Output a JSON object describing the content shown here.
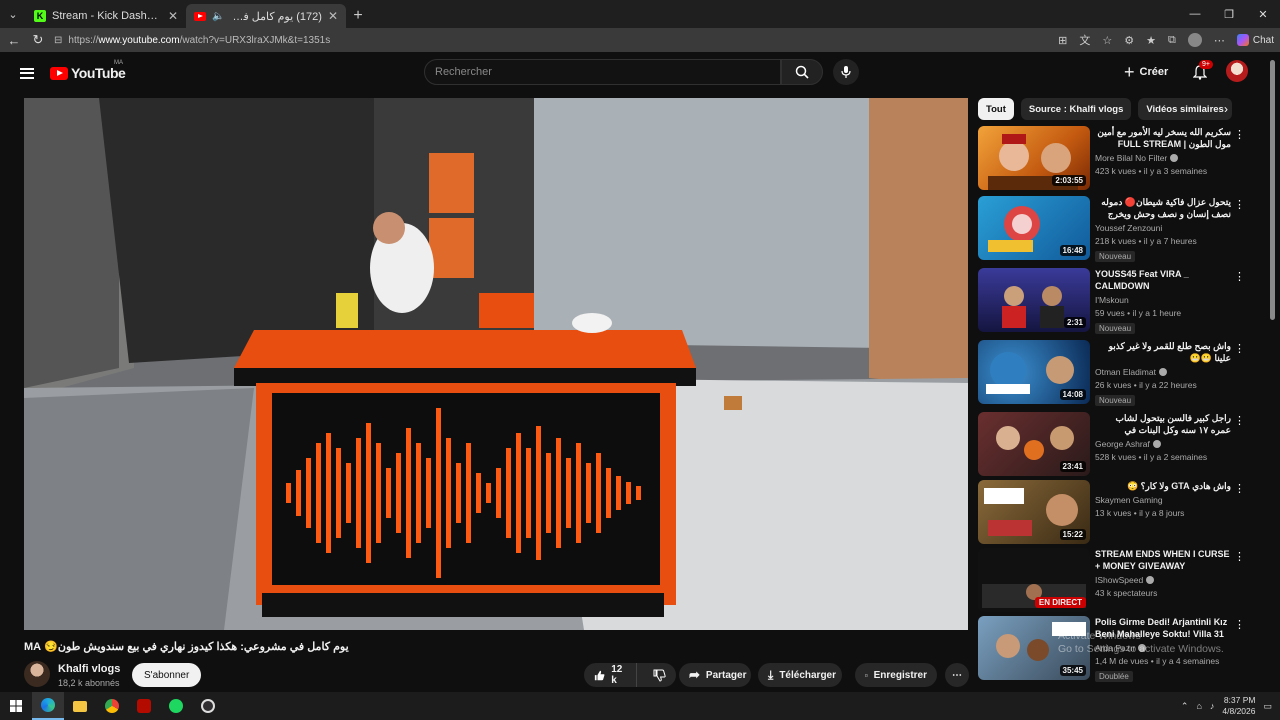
{
  "browser": {
    "tabs": [
      {
        "title": "Stream - Kick Dashboard",
        "active": false
      },
      {
        "title": "(172) يوم كامل في مشروعي: ه",
        "active": true
      }
    ],
    "url_prefix": "https://",
    "url_domain": "www.youtube.com",
    "url_path": "/watch?v=URX3lraXJMk&t=1351s",
    "chat_label": "Chat"
  },
  "header": {
    "logo_text": "YouTube",
    "country_code": "MA",
    "search_placeholder": "Rechercher",
    "create_label": "Créer",
    "notifications_badge": "9+"
  },
  "video": {
    "title": "يوم كامل في مشروعي: هكذا كيدوز نهاري في بيع سندويش طون😏 MA",
    "channel_name": "Khalfi vlogs",
    "subscribers": "18,2 k abonnés",
    "subscribe_label": "S'abonner",
    "likes": "12 k",
    "share_label": "Partager",
    "download_label": "Télécharger",
    "save_label": "Enregistrer"
  },
  "chips": [
    {
      "label": "Tout",
      "active": true
    },
    {
      "label": "Source : Khalfi vlogs",
      "active": false
    },
    {
      "label": "Vidéos similaires",
      "active": false
    }
  ],
  "recommendations": [
    {
      "title": "سكريم الله يسخر ليه الأمور مع أمين مول الطون | FULL STREAM",
      "rtl": true,
      "channel": "More Bilal No Filter",
      "verified": true,
      "meta": "423 k vues • il y a 3 semaines",
      "duration": "2:03:55",
      "badge": "",
      "live": false
    },
    {
      "title": "يتحول عزال فاكية شيطان🔴 دموله نصف إنسان و نصف وحش ويخرج الابحث عن كنز",
      "rtl": true,
      "channel": "Youssef Zenzouni",
      "verified": false,
      "meta": "218 k vues • il y a 7 heures",
      "duration": "16:48",
      "badge": "Nouveau",
      "live": false
    },
    {
      "title": "YOUSS45 Feat VIRA _ CALMDOWN",
      "rtl": false,
      "channel": "I'Mskoun",
      "verified": false,
      "meta": "59 vues • il y a 1 heure",
      "duration": "2:31",
      "badge": "Nouveau",
      "live": false
    },
    {
      "title": "واش بصح طلع للقمر ولا غير كذبو علينا 😬😬",
      "rtl": true,
      "channel": "Otman Eladimat",
      "verified": true,
      "meta": "26 k vues • il y a 22 heures",
      "duration": "14:08",
      "badge": "Nouveau",
      "live": false
    },
    {
      "title": "راجل كبير فالسن بيتحول لشاب عمره ١٧ سنه وكل البنات في المدرسه اصبحو معجبين بيه",
      "rtl": true,
      "channel": "George Ashraf",
      "verified": true,
      "meta": "528 k vues • il y a 2 semaines",
      "duration": "23:41",
      "badge": "",
      "live": false
    },
    {
      "title": "واش هادي GTA ولا كار؟ 😳",
      "rtl": true,
      "channel": "Skaymen Gaming",
      "verified": false,
      "meta": "13 k vues • il y a 8 jours",
      "duration": "15:22",
      "badge": "",
      "live": false
    },
    {
      "title": "STREAM ENDS WHEN I CURSE + MONEY GIVEAWAY",
      "rtl": false,
      "channel": "IShowSpeed",
      "verified": true,
      "meta": "43 k spectateurs",
      "duration": "EN DIRECT",
      "badge": "",
      "live": true
    },
    {
      "title": "Polis Girme Dedi! Arjantinli Kız Beni Mahalleye Soktu! Villa 31",
      "rtl": false,
      "channel": "Arda Pazır",
      "verified": true,
      "meta": "1,4 M de vues • il y a 4 semaines",
      "duration": "35:45",
      "badge": "Doublée",
      "live": false
    }
  ],
  "windows_watermark": {
    "line1": "Activate Windows",
    "line2": "Go to Settings to activate Windows."
  },
  "taskbar": {
    "time": "8:37 PM",
    "date": "4/8/2026"
  }
}
